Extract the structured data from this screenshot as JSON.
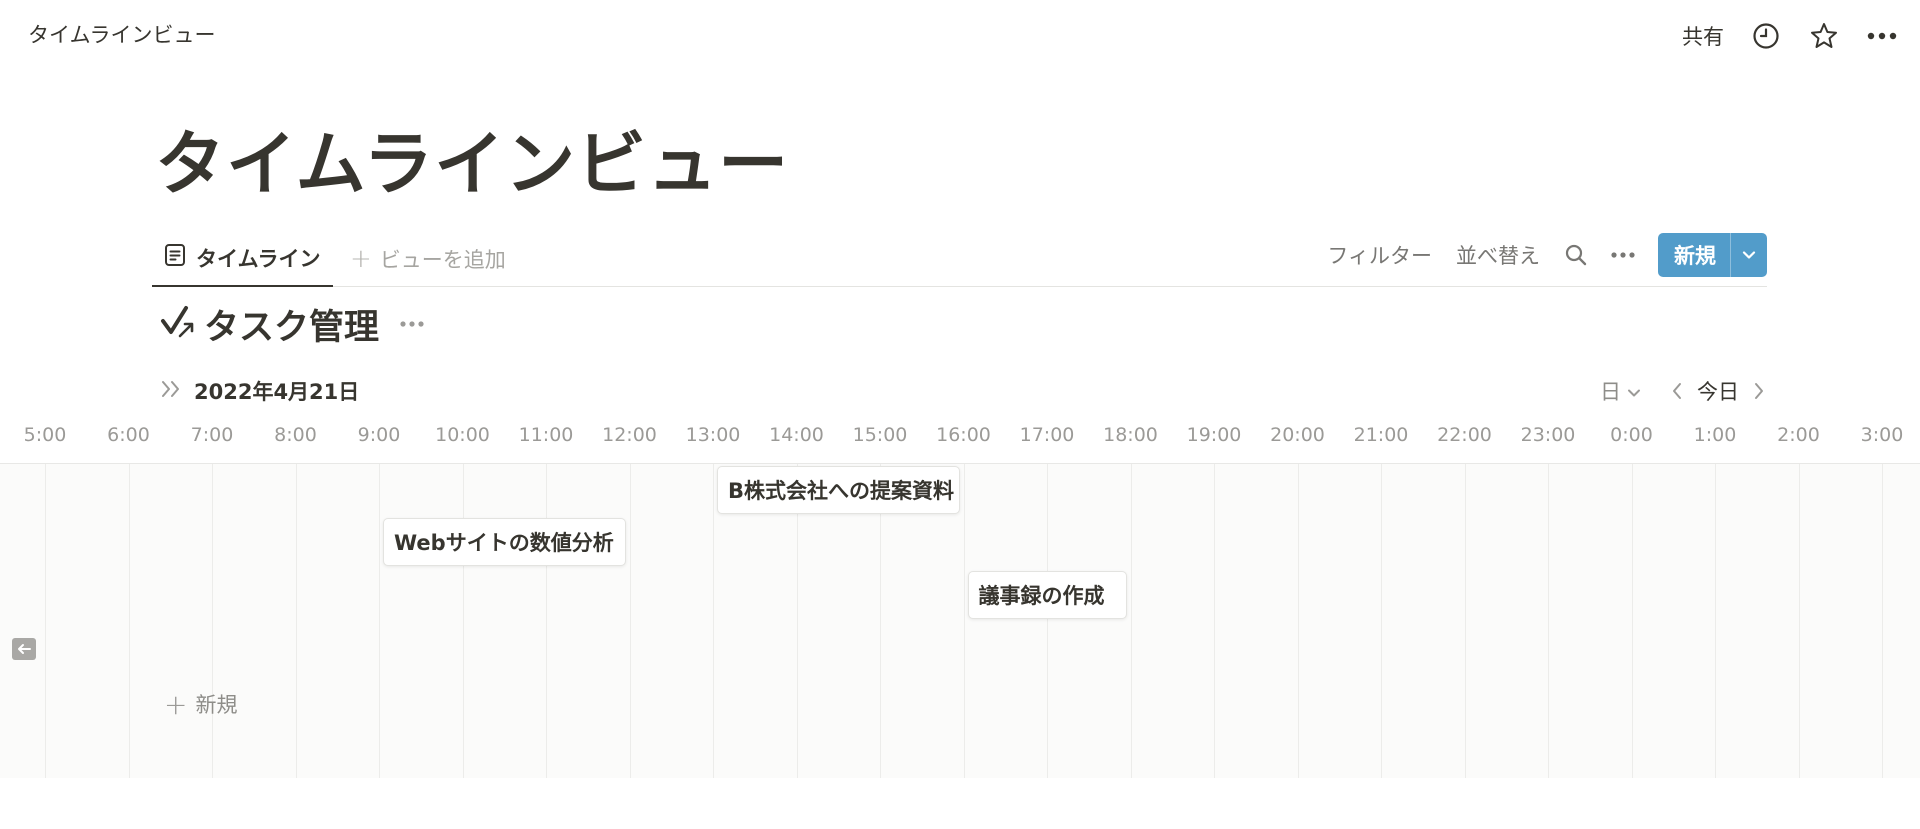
{
  "breadcrumb": "タイムラインビュー",
  "topbar": {
    "share_label": "共有",
    "icons": [
      "clock-icon",
      "star-icon",
      "more-icon"
    ]
  },
  "page": {
    "title": "タイムラインビュー"
  },
  "views": {
    "active_tab": "タイムライン",
    "add_view_label": "ビューを追加",
    "filter_label": "フィルター",
    "sort_label": "並べ替え",
    "new_label": "新規",
    "accent_color": "#529cca"
  },
  "database": {
    "title": "タスク管理"
  },
  "timeline": {
    "date": "2022年4月21日",
    "zoom": "日",
    "today_label": "今日",
    "hours": [
      "5:00",
      "6:00",
      "7:00",
      "8:00",
      "9:00",
      "10:00",
      "11:00",
      "12:00",
      "13:00",
      "14:00",
      "15:00",
      "16:00",
      "17:00",
      "18:00",
      "19:00",
      "20:00",
      "21:00",
      "22:00",
      "23:00",
      "0:00",
      "1:00",
      "2:00",
      "3:00"
    ],
    "tasks": [
      {
        "title": "B株式会社への提案資料",
        "start": "13:00",
        "end": "16:00"
      },
      {
        "title": "Webサイトの数値分析",
        "start": "9:00",
        "end": "12:00"
      },
      {
        "title": "議事録の作成",
        "start": "16:00",
        "end": "18:00"
      }
    ],
    "new_label": "新規"
  }
}
